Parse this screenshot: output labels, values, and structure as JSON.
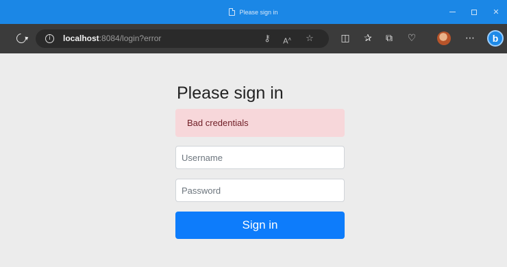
{
  "window": {
    "title": "Please sign in"
  },
  "toolbar": {
    "url_host": "localhost",
    "url_rest": ":8084/login?error",
    "icons": {
      "refresh": "refresh-icon",
      "site_info": "info-icon",
      "key": "key-icon",
      "read_aloud": "read-aloud-icon",
      "favorite": "star-icon",
      "split_screen": "split-screen-icon",
      "favorites_list": "favorites-icon",
      "collections": "collections-icon",
      "health": "browser-essentials-icon",
      "profile": "avatar-icon",
      "more": "more-icon",
      "copilot": "bing-icon"
    }
  },
  "login": {
    "heading": "Please sign in",
    "error_message": "Bad credentials",
    "username_placeholder": "Username",
    "password_placeholder": "Password",
    "submit_label": "Sign in"
  },
  "colors": {
    "titlebar": "#1b87e6",
    "toolbar": "#3b3b3b",
    "page_background": "#ececec",
    "alert_background": "#f7d7da",
    "alert_text": "#6e1c24",
    "primary_button": "#0d7cfb"
  }
}
